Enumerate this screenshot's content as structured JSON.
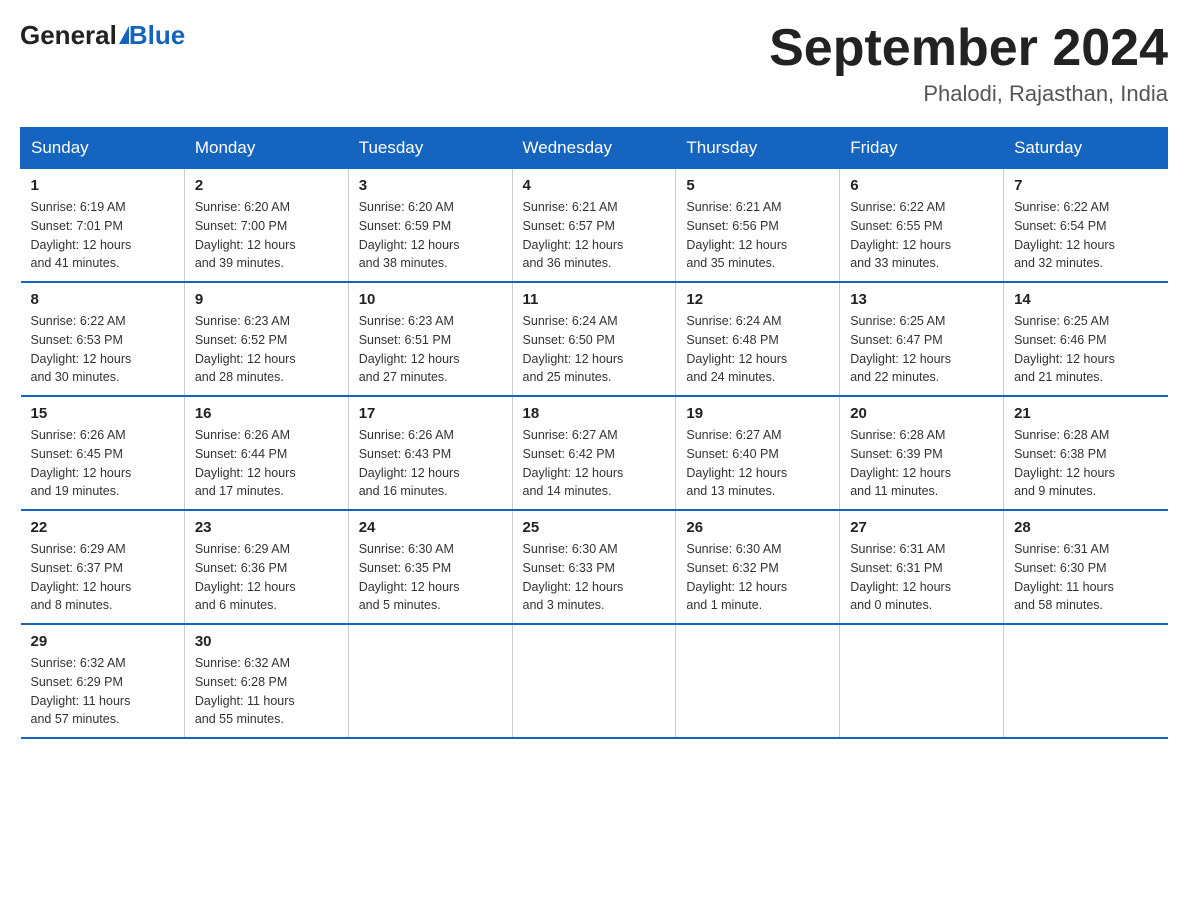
{
  "header": {
    "logo": {
      "general": "General",
      "blue": "Blue"
    },
    "title": "September 2024",
    "subtitle": "Phalodi, Rajasthan, India"
  },
  "days_of_week": [
    "Sunday",
    "Monday",
    "Tuesday",
    "Wednesday",
    "Thursday",
    "Friday",
    "Saturday"
  ],
  "weeks": [
    [
      {
        "day": "1",
        "sunrise": "6:19 AM",
        "sunset": "7:01 PM",
        "daylight": "12 hours and 41 minutes."
      },
      {
        "day": "2",
        "sunrise": "6:20 AM",
        "sunset": "7:00 PM",
        "daylight": "12 hours and 39 minutes."
      },
      {
        "day": "3",
        "sunrise": "6:20 AM",
        "sunset": "6:59 PM",
        "daylight": "12 hours and 38 minutes."
      },
      {
        "day": "4",
        "sunrise": "6:21 AM",
        "sunset": "6:57 PM",
        "daylight": "12 hours and 36 minutes."
      },
      {
        "day": "5",
        "sunrise": "6:21 AM",
        "sunset": "6:56 PM",
        "daylight": "12 hours and 35 minutes."
      },
      {
        "day": "6",
        "sunrise": "6:22 AM",
        "sunset": "6:55 PM",
        "daylight": "12 hours and 33 minutes."
      },
      {
        "day": "7",
        "sunrise": "6:22 AM",
        "sunset": "6:54 PM",
        "daylight": "12 hours and 32 minutes."
      }
    ],
    [
      {
        "day": "8",
        "sunrise": "6:22 AM",
        "sunset": "6:53 PM",
        "daylight": "12 hours and 30 minutes."
      },
      {
        "day": "9",
        "sunrise": "6:23 AM",
        "sunset": "6:52 PM",
        "daylight": "12 hours and 28 minutes."
      },
      {
        "day": "10",
        "sunrise": "6:23 AM",
        "sunset": "6:51 PM",
        "daylight": "12 hours and 27 minutes."
      },
      {
        "day": "11",
        "sunrise": "6:24 AM",
        "sunset": "6:50 PM",
        "daylight": "12 hours and 25 minutes."
      },
      {
        "day": "12",
        "sunrise": "6:24 AM",
        "sunset": "6:48 PM",
        "daylight": "12 hours and 24 minutes."
      },
      {
        "day": "13",
        "sunrise": "6:25 AM",
        "sunset": "6:47 PM",
        "daylight": "12 hours and 22 minutes."
      },
      {
        "day": "14",
        "sunrise": "6:25 AM",
        "sunset": "6:46 PM",
        "daylight": "12 hours and 21 minutes."
      }
    ],
    [
      {
        "day": "15",
        "sunrise": "6:26 AM",
        "sunset": "6:45 PM",
        "daylight": "12 hours and 19 minutes."
      },
      {
        "day": "16",
        "sunrise": "6:26 AM",
        "sunset": "6:44 PM",
        "daylight": "12 hours and 17 minutes."
      },
      {
        "day": "17",
        "sunrise": "6:26 AM",
        "sunset": "6:43 PM",
        "daylight": "12 hours and 16 minutes."
      },
      {
        "day": "18",
        "sunrise": "6:27 AM",
        "sunset": "6:42 PM",
        "daylight": "12 hours and 14 minutes."
      },
      {
        "day": "19",
        "sunrise": "6:27 AM",
        "sunset": "6:40 PM",
        "daylight": "12 hours and 13 minutes."
      },
      {
        "day": "20",
        "sunrise": "6:28 AM",
        "sunset": "6:39 PM",
        "daylight": "12 hours and 11 minutes."
      },
      {
        "day": "21",
        "sunrise": "6:28 AM",
        "sunset": "6:38 PM",
        "daylight": "12 hours and 9 minutes."
      }
    ],
    [
      {
        "day": "22",
        "sunrise": "6:29 AM",
        "sunset": "6:37 PM",
        "daylight": "12 hours and 8 minutes."
      },
      {
        "day": "23",
        "sunrise": "6:29 AM",
        "sunset": "6:36 PM",
        "daylight": "12 hours and 6 minutes."
      },
      {
        "day": "24",
        "sunrise": "6:30 AM",
        "sunset": "6:35 PM",
        "daylight": "12 hours and 5 minutes."
      },
      {
        "day": "25",
        "sunrise": "6:30 AM",
        "sunset": "6:33 PM",
        "daylight": "12 hours and 3 minutes."
      },
      {
        "day": "26",
        "sunrise": "6:30 AM",
        "sunset": "6:32 PM",
        "daylight": "12 hours and 1 minute."
      },
      {
        "day": "27",
        "sunrise": "6:31 AM",
        "sunset": "6:31 PM",
        "daylight": "12 hours and 0 minutes."
      },
      {
        "day": "28",
        "sunrise": "6:31 AM",
        "sunset": "6:30 PM",
        "daylight": "11 hours and 58 minutes."
      }
    ],
    [
      {
        "day": "29",
        "sunrise": "6:32 AM",
        "sunset": "6:29 PM",
        "daylight": "11 hours and 57 minutes."
      },
      {
        "day": "30",
        "sunrise": "6:32 AM",
        "sunset": "6:28 PM",
        "daylight": "11 hours and 55 minutes."
      },
      null,
      null,
      null,
      null,
      null
    ]
  ],
  "labels": {
    "sunrise": "Sunrise:",
    "sunset": "Sunset:",
    "daylight": "Daylight:"
  }
}
